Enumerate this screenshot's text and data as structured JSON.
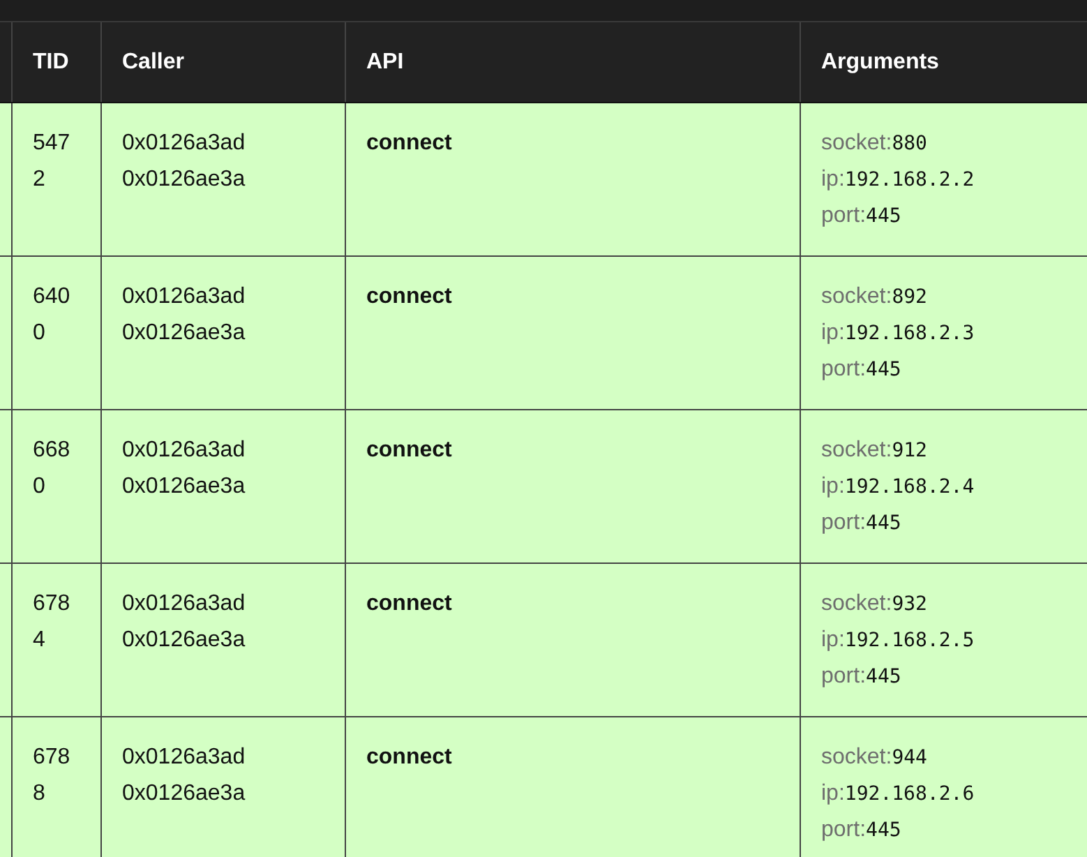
{
  "table": {
    "columns": [
      {
        "label": "TID"
      },
      {
        "label": "Caller"
      },
      {
        "label": "API"
      },
      {
        "label": "Arguments"
      }
    ],
    "rows": [
      {
        "tid": "5472",
        "callers": [
          "0x0126a3ad",
          "0x0126ae3a"
        ],
        "api": "connect",
        "arguments": [
          {
            "name": "socket:",
            "value": "880"
          },
          {
            "name": "ip:",
            "value": "192.168.2.2"
          },
          {
            "name": "port:",
            "value": "445"
          }
        ]
      },
      {
        "tid": "6400",
        "callers": [
          "0x0126a3ad",
          "0x0126ae3a"
        ],
        "api": "connect",
        "arguments": [
          {
            "name": "socket:",
            "value": "892"
          },
          {
            "name": "ip:",
            "value": "192.168.2.3"
          },
          {
            "name": "port:",
            "value": "445"
          }
        ]
      },
      {
        "tid": "6680",
        "callers": [
          "0x0126a3ad",
          "0x0126ae3a"
        ],
        "api": "connect",
        "arguments": [
          {
            "name": "socket:",
            "value": "912"
          },
          {
            "name": "ip:",
            "value": "192.168.2.4"
          },
          {
            "name": "port:",
            "value": "445"
          }
        ]
      },
      {
        "tid": "6784",
        "callers": [
          "0x0126a3ad",
          "0x0126ae3a"
        ],
        "api": "connect",
        "arguments": [
          {
            "name": "socket:",
            "value": "932"
          },
          {
            "name": "ip:",
            "value": "192.168.2.5"
          },
          {
            "name": "port:",
            "value": "445"
          }
        ]
      },
      {
        "tid": "6788",
        "callers": [
          "0x0126a3ad",
          "0x0126ae3a"
        ],
        "api": "connect",
        "arguments": [
          {
            "name": "socket:",
            "value": "944"
          },
          {
            "name": "ip:",
            "value": "192.168.2.6"
          },
          {
            "name": "port:",
            "value": "445"
          }
        ]
      }
    ]
  }
}
